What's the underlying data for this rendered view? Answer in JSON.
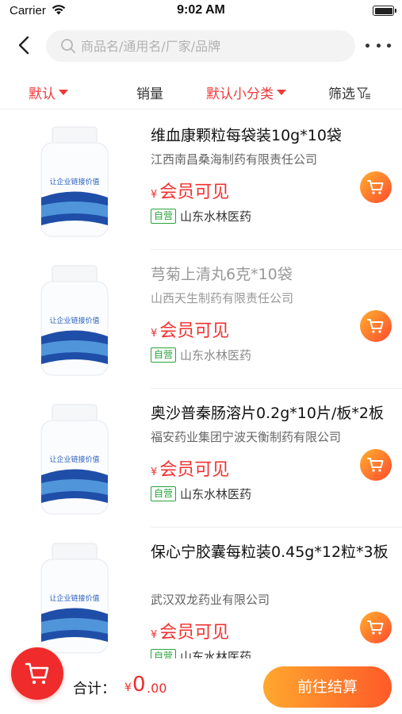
{
  "status_bar": {
    "carrier": "Carrier",
    "time": "9:02 AM"
  },
  "search": {
    "placeholder": "商品名/通用名/厂家/品牌"
  },
  "filters": {
    "default": "默认",
    "sales": "销量",
    "subcategory": "默认小分类",
    "filter": "筛选"
  },
  "products": [
    {
      "title": "维血康颗粒每袋装10g*10袋",
      "manufacturer": "江西南昌桑海制药有限责任公司",
      "yen": "¥",
      "price_text": "会员可见",
      "badge": "自营",
      "store": "山东水林医药",
      "label_text": "让企业链接价值",
      "disabled": false
    },
    {
      "title": "芎菊上清丸6克*10袋",
      "manufacturer": "山西天生制药有限责任公司",
      "yen": "¥",
      "price_text": "会员可见",
      "badge": "自营",
      "store": "山东水林医药",
      "label_text": "让企业链接价值",
      "disabled": true
    },
    {
      "title": "奥沙普秦肠溶片0.2g*10片/板*2板",
      "manufacturer": "福安药业集团宁波天衡制药有限公司",
      "yen": "¥",
      "price_text": "会员可见",
      "badge": "自营",
      "store": "山东水林医药",
      "label_text": "让企业链接价值",
      "disabled": false
    },
    {
      "title": "保心宁胶囊每粒装0.45g*12粒*3板",
      "manufacturer": "武汉双龙药业有限公司",
      "yen": "¥",
      "price_text": "会员可见",
      "badge": "自营",
      "store": "山东水林医药",
      "label_text": "让企业链接价值",
      "disabled": false
    }
  ],
  "footer": {
    "total_label": "合计：",
    "total_yen": "¥",
    "total_int": "0",
    "total_dec": ".00",
    "checkout": "前往结算"
  },
  "colors": {
    "accent_red": "#f02b2b",
    "orange_start": "#ffa82e",
    "orange_end": "#fe5a28",
    "green_badge": "#27a33a"
  },
  "icons": [
    "wifi-icon",
    "battery-icon",
    "back-icon",
    "search-icon",
    "more-icon",
    "triangle-down-icon",
    "filter-funnel-icon",
    "cart-icon"
  ]
}
